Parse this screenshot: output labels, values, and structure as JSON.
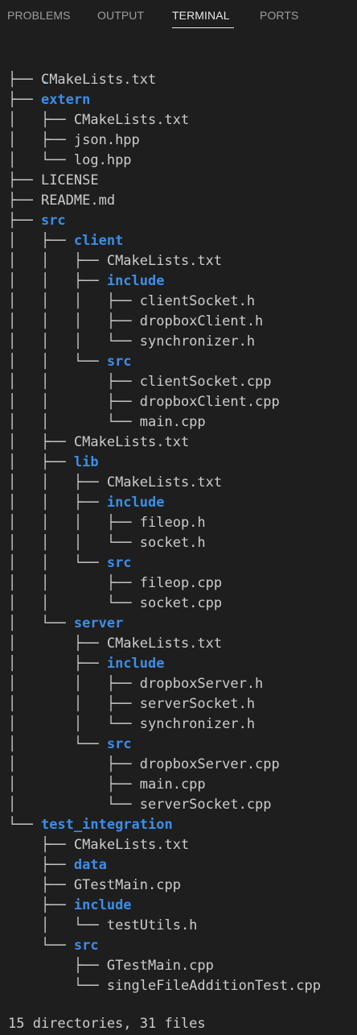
{
  "tabs": [
    {
      "label": "PROBLEMS"
    },
    {
      "label": "OUTPUT"
    },
    {
      "label": "TERMINAL",
      "active": true
    },
    {
      "label": "PORTS"
    }
  ],
  "tree": {
    "root": ".",
    "lines": [
      {
        "prefix": "├── ",
        "name": "CMakeLists.txt",
        "dir": false
      },
      {
        "prefix": "├── ",
        "name": "extern",
        "dir": true
      },
      {
        "prefix": "│   ├── ",
        "name": "CMakeLists.txt",
        "dir": false
      },
      {
        "prefix": "│   ├── ",
        "name": "json.hpp",
        "dir": false
      },
      {
        "prefix": "│   └── ",
        "name": "log.hpp",
        "dir": false
      },
      {
        "prefix": "├── ",
        "name": "LICENSE",
        "dir": false
      },
      {
        "prefix": "├── ",
        "name": "README.md",
        "dir": false
      },
      {
        "prefix": "├── ",
        "name": "src",
        "dir": true
      },
      {
        "prefix": "│   ├── ",
        "name": "client",
        "dir": true
      },
      {
        "prefix": "│   │   ├── ",
        "name": "CMakeLists.txt",
        "dir": false
      },
      {
        "prefix": "│   │   ├── ",
        "name": "include",
        "dir": true
      },
      {
        "prefix": "│   │   │   ├── ",
        "name": "clientSocket.h",
        "dir": false
      },
      {
        "prefix": "│   │   │   ├── ",
        "name": "dropboxClient.h",
        "dir": false
      },
      {
        "prefix": "│   │   │   └── ",
        "name": "synchronizer.h",
        "dir": false
      },
      {
        "prefix": "│   │   └── ",
        "name": "src",
        "dir": true
      },
      {
        "prefix": "│   │       ├── ",
        "name": "clientSocket.cpp",
        "dir": false
      },
      {
        "prefix": "│   │       ├── ",
        "name": "dropboxClient.cpp",
        "dir": false
      },
      {
        "prefix": "│   │       └── ",
        "name": "main.cpp",
        "dir": false
      },
      {
        "prefix": "│   ├── ",
        "name": "CMakeLists.txt",
        "dir": false
      },
      {
        "prefix": "│   ├── ",
        "name": "lib",
        "dir": true
      },
      {
        "prefix": "│   │   ├── ",
        "name": "CMakeLists.txt",
        "dir": false
      },
      {
        "prefix": "│   │   ├── ",
        "name": "include",
        "dir": true
      },
      {
        "prefix": "│   │   │   ├── ",
        "name": "fileop.h",
        "dir": false
      },
      {
        "prefix": "│   │   │   └── ",
        "name": "socket.h",
        "dir": false
      },
      {
        "prefix": "│   │   └── ",
        "name": "src",
        "dir": true
      },
      {
        "prefix": "│   │       ├── ",
        "name": "fileop.cpp",
        "dir": false
      },
      {
        "prefix": "│   │       └── ",
        "name": "socket.cpp",
        "dir": false
      },
      {
        "prefix": "│   └── ",
        "name": "server",
        "dir": true
      },
      {
        "prefix": "│       ├── ",
        "name": "CMakeLists.txt",
        "dir": false
      },
      {
        "prefix": "│       ├── ",
        "name": "include",
        "dir": true
      },
      {
        "prefix": "│       │   ├── ",
        "name": "dropboxServer.h",
        "dir": false
      },
      {
        "prefix": "│       │   ├── ",
        "name": "serverSocket.h",
        "dir": false
      },
      {
        "prefix": "│       │   └── ",
        "name": "synchronizer.h",
        "dir": false
      },
      {
        "prefix": "│       └── ",
        "name": "src",
        "dir": true
      },
      {
        "prefix": "│           ├── ",
        "name": "dropboxServer.cpp",
        "dir": false
      },
      {
        "prefix": "│           ├── ",
        "name": "main.cpp",
        "dir": false
      },
      {
        "prefix": "│           └── ",
        "name": "serverSocket.cpp",
        "dir": false
      },
      {
        "prefix": "└── ",
        "name": "test_integration",
        "dir": true
      },
      {
        "prefix": "    ├── ",
        "name": "CMakeLists.txt",
        "dir": false
      },
      {
        "prefix": "    ├── ",
        "name": "data",
        "dir": true
      },
      {
        "prefix": "    ├── ",
        "name": "GTestMain.cpp",
        "dir": false
      },
      {
        "prefix": "    ├── ",
        "name": "include",
        "dir": true
      },
      {
        "prefix": "    │   └── ",
        "name": "testUtils.h",
        "dir": false
      },
      {
        "prefix": "    └── ",
        "name": "src",
        "dir": true
      },
      {
        "prefix": "        ├── ",
        "name": "GTestMain.cpp",
        "dir": false
      },
      {
        "prefix": "        └── ",
        "name": "singleFileAdditionTest.cpp",
        "dir": false
      }
    ]
  },
  "summary": "15 directories, 31 files",
  "colors": {
    "background": "#1e1e1e",
    "text": "#cccccc",
    "directory": "#3b8eea",
    "tab_inactive": "#9d9d9d",
    "tab_active": "#e7e7e7"
  }
}
